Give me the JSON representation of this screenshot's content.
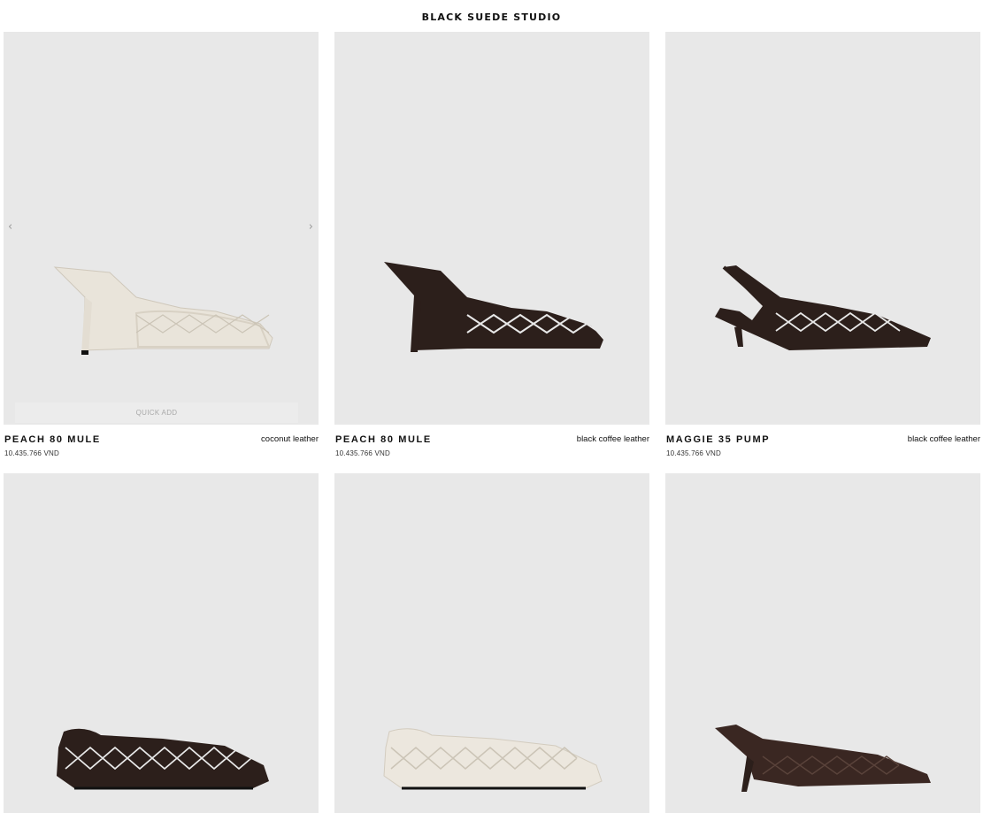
{
  "header": {
    "brand": "BLACK SUEDE STUDIO"
  },
  "products": [
    {
      "name": "PEACH 80 MULE",
      "price": "10.435.766 VND",
      "color": "coconut leather",
      "quick_add": "QUICK ADD",
      "prev": "‹",
      "next": "›"
    },
    {
      "name": "PEACH 80 MULE",
      "price": "10.435.766 VND",
      "color": "black coffee leather"
    },
    {
      "name": "MAGGIE 35 PUMP",
      "price": "10.435.766 VND",
      "color": "black coffee leather"
    }
  ],
  "shoe_colors": {
    "coconut": "#ece7de",
    "coffee": "#2c1f1b",
    "brown": "#3a2722"
  }
}
